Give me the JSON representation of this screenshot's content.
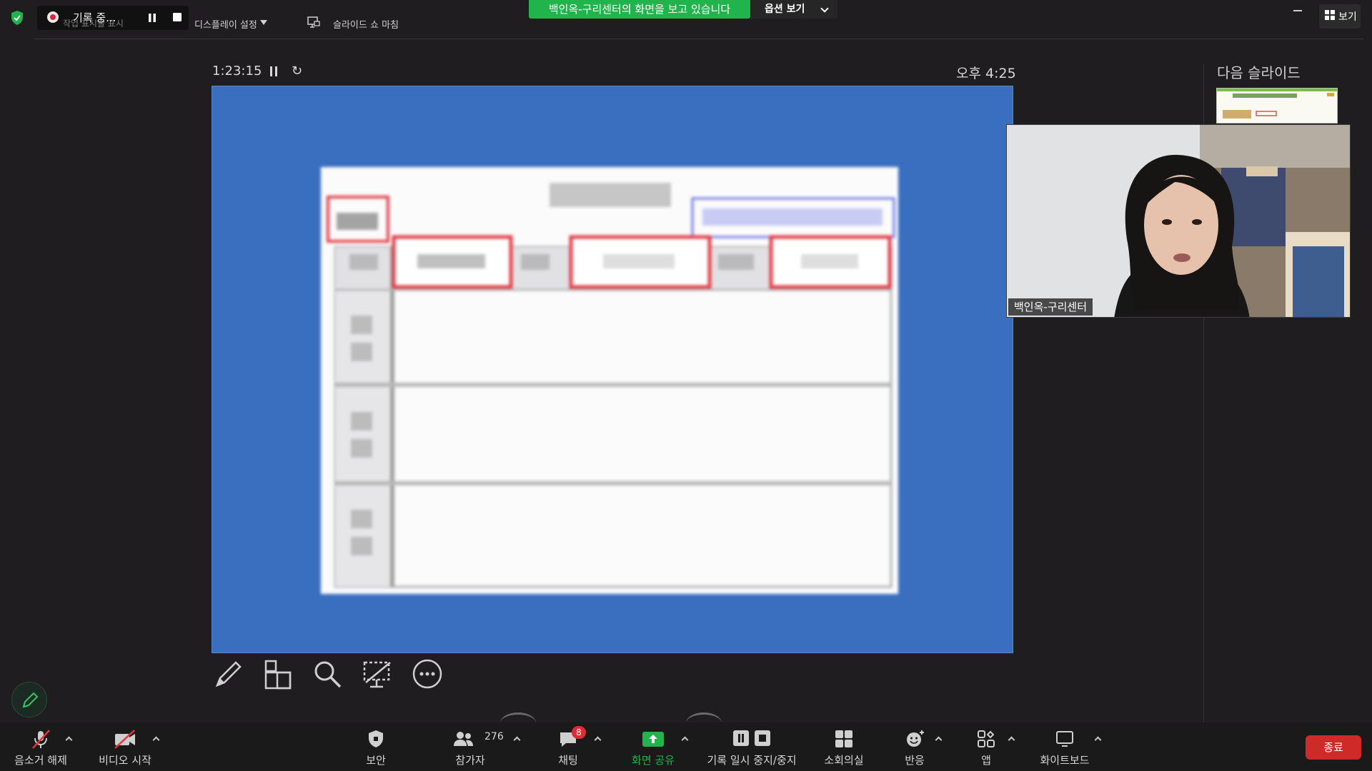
{
  "top_bar": {
    "recording_label": "기록 중...",
    "ghost_text": "작업 표시줄 표시",
    "display_settings": "디스플레이 설정",
    "end_slideshow": "슬라이드 쇼 마침",
    "share_banner": "백인옥-구리센터의 화면을 보고 있습니다",
    "view_options": "옵션 보기",
    "view_label": "보기"
  },
  "presenter": {
    "timer": "1:23:15",
    "clock": "오후 4:25",
    "next_slide_label": "다음 슬라이드"
  },
  "video": {
    "participant_name": "백인옥-구리센터"
  },
  "toolbar": {
    "mute_label": "음소거 해제",
    "video_label": "비디오 시작",
    "security_label": "보안",
    "participants_label": "참가자",
    "participants_count": "276",
    "chat_label": "채팅",
    "chat_badge": "8",
    "share_label": "화면 공유",
    "record_label": "기록 일시 중지/중지",
    "breakout_label": "소회의실",
    "reactions_label": "반응",
    "apps_label": "앱",
    "whiteboard_label": "화이트보드",
    "end_label": "종료"
  },
  "colors": {
    "background": "#1f1d1f",
    "share_green": "#22b44c",
    "slide_blue": "#3a6fc0",
    "end_red": "#cf2a28",
    "highlight_red": "#e2404a",
    "highlight_blue": "#6f79e6"
  },
  "icons": {
    "security": "shield-icon",
    "recording": "record-dot-icon",
    "mute": "mic-off-icon",
    "video": "camera-off-icon",
    "participants": "people-icon",
    "chat": "chat-bubble-icon",
    "share": "share-arrow-icon",
    "breakout": "grid-icon",
    "reactions": "smiley-plus-icon",
    "apps": "apps-icon",
    "whiteboard": "whiteboard-icon",
    "pen": "pen-icon"
  }
}
